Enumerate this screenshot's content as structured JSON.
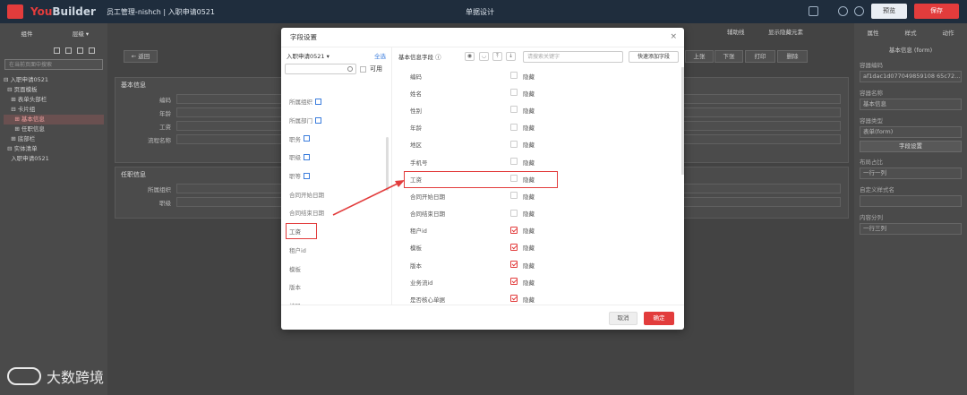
{
  "header": {
    "brand_you": "You",
    "brand_builder": "Builder",
    "crumb": "员工管理-nishch | 入职申请0521",
    "center_title": "单据设计",
    "preview_label": "预览",
    "save_label": "保存"
  },
  "left_panel": {
    "tabs": [
      "组件",
      "层级 ▾"
    ],
    "search_placeholder": "在当前页面中搜索",
    "tree": [
      "⊟ 入职申请0521",
      "  ⊟ 页面模板",
      "    ⊞ 表单头部栏",
      "    ⊟ 卡片组",
      "      ⊞ 基本信息",
      "      ⊞ 任职信息",
      "    ⊞ 底部栏",
      "  ⊟ 实体清单",
      "    入职申请0521"
    ],
    "tree_selected_index": 4
  },
  "canvas": {
    "back_label": "← 返回",
    "top_opts": [
      "辅助线",
      "显示隐藏元素"
    ],
    "right_buttons": [
      "上张",
      "下张",
      "打印",
      "删除"
    ],
    "section1_title": "基本信息",
    "section1_rows": [
      "编码",
      "年龄",
      "工资",
      "流程名称"
    ],
    "section2_title": "任职信息",
    "section2_rows": [
      "所属组织",
      "职级"
    ]
  },
  "right_panel": {
    "tabs": [
      "属性",
      "样式",
      "动作"
    ],
    "panel_title": "基本信息 (form)",
    "fields": [
      {
        "label": "容器编码",
        "value": "af1dac1d077049859108 65c72..."
      },
      {
        "label": "容器名称",
        "value": "基本信息"
      },
      {
        "label": "容器类型",
        "value": "表单(form)"
      }
    ],
    "button_label": "字段设置",
    "fields2": [
      {
        "label": "布局占比",
        "value": "一行一列"
      },
      {
        "label": "自定义样式名",
        "value": ""
      },
      {
        "label": "内容分列",
        "value": "一行三列"
      }
    ]
  },
  "watermark": "大数跨境",
  "modal": {
    "title": "字段设置",
    "close": "×",
    "entity_select": "入职申请0521 ▾",
    "select_all": "全选",
    "available_label": "可用",
    "left_items": [
      {
        "label": "所属组织",
        "tag": true
      },
      {
        "label": "所属部门",
        "tag": true
      },
      {
        "label": "职务",
        "tag": true
      },
      {
        "label": "职级",
        "tag": true
      },
      {
        "label": "职等",
        "tag": true
      },
      {
        "label": "合同开始日期",
        "tag": false
      },
      {
        "label": "合同结束日期",
        "tag": false
      },
      {
        "label": "工资",
        "tag": false
      },
      {
        "label": "租户id",
        "tag": false
      },
      {
        "label": "模板",
        "tag": false
      },
      {
        "label": "版本",
        "tag": false
      },
      {
        "label": "编码",
        "tag": false
      }
    ],
    "left_highlight_index": 7,
    "right_header": "基本信息字段 ⓘ",
    "search_placeholder": "请搜索关键字",
    "quick_add": "快速添加字段",
    "hide_label": "隐藏",
    "right_rows": [
      {
        "name": "编码",
        "hidden": false
      },
      {
        "name": "姓名",
        "hidden": false
      },
      {
        "name": "性别",
        "hidden": false
      },
      {
        "name": "年龄",
        "hidden": false
      },
      {
        "name": "地区",
        "hidden": false
      },
      {
        "name": "手机号",
        "hidden": false
      },
      {
        "name": "工资",
        "hidden": false
      },
      {
        "name": "合同开始日期",
        "hidden": false
      },
      {
        "name": "合同结束日期",
        "hidden": false
      },
      {
        "name": "租户id",
        "hidden": true
      },
      {
        "name": "模板",
        "hidden": true
      },
      {
        "name": "版本",
        "hidden": true
      },
      {
        "name": "业务流id",
        "hidden": true
      },
      {
        "name": "是否核心单据",
        "hidden": true
      }
    ],
    "right_highlight_index": 6,
    "cancel_label": "取消",
    "ok_label": "确定"
  },
  "colors": {
    "accent": "#e23c3c",
    "link": "#3b7ddd",
    "topbar": "#1f2d3d"
  }
}
